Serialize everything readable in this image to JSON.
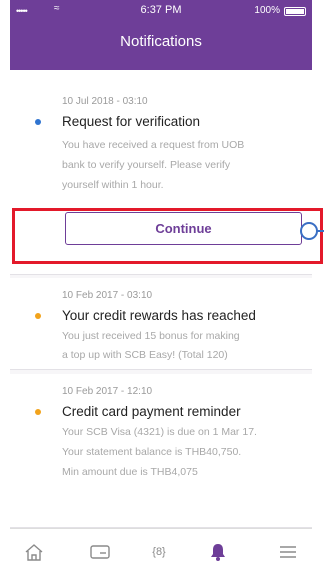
{
  "status_bar": {
    "signal": "•••••",
    "wifi": "≈",
    "time": "6:37 PM",
    "battery": "100%"
  },
  "header": {
    "title": "Notifications"
  },
  "notifications": [
    {
      "date": "10 Jul 2018 - 03:10",
      "title": "Request for verification",
      "body": [
        "You have received a request from UOB",
        "bank to verify yourself. Please verify",
        "yourself within 1 hour."
      ],
      "dot_color": "#2f74d0",
      "action_label": "Continue"
    },
    {
      "date": "10 Feb 2017 - 03:10",
      "title": "Your credit rewards has reached",
      "body": [
        "You just received 15 bonus for making",
        "a top up with SCB Easy! (Total 120)"
      ],
      "dot_color": "#f2a31b"
    },
    {
      "date": "10 Feb 2017 - 12:10",
      "title": "Credit card payment reminder",
      "body": [
        "Your SCB Visa (4321) is due on 1 Mar 17.",
        "Your statement balance is THB40,750.",
        "Min amount due is THB4,075"
      ],
      "dot_color": "#f2a31b"
    }
  ],
  "tabbar": {
    "items": [
      "home-icon",
      "card-icon",
      "rewards-icon",
      "notifications-icon",
      "menu-icon"
    ],
    "rewards_glyph": "{8}",
    "active_color": "#6e3e98",
    "inactive_color": "#8a8a8a"
  },
  "colors": {
    "brand": "#6e3e98",
    "highlight": "#e3192a"
  }
}
